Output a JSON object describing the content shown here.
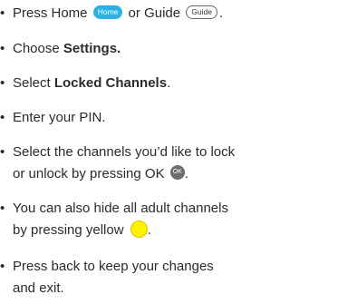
{
  "instructions": {
    "step1": {
      "prefix": "Press Home ",
      "home_button": "Home",
      "middle": " or Guide ",
      "guide_button": "Guide",
      "suffix": "."
    },
    "step2": {
      "prefix": "Choose ",
      "bold": "Settings."
    },
    "step3": {
      "prefix": "Select ",
      "bold": "Locked Channels",
      "suffix": "."
    },
    "step4": {
      "text": "Enter your PIN."
    },
    "step5": {
      "line1": "Select the channels you’d like to lock",
      "line2_prefix": "or unlock by pressing OK ",
      "ok_button": "OK",
      "suffix": "."
    },
    "step6": {
      "line1": "You can also hide all adult channels",
      "line2_prefix": "by pressing yellow ",
      "yellow_button_icon": "yellow-circle-button",
      "suffix": "."
    },
    "step7": {
      "line1": "Press back to keep your changes",
      "line2": "and exit."
    }
  },
  "colors": {
    "home_button": "#2ab2e6",
    "ok_button": "#6d6d6d",
    "yellow_button": "#fff200",
    "text": "#2b2b2b"
  }
}
